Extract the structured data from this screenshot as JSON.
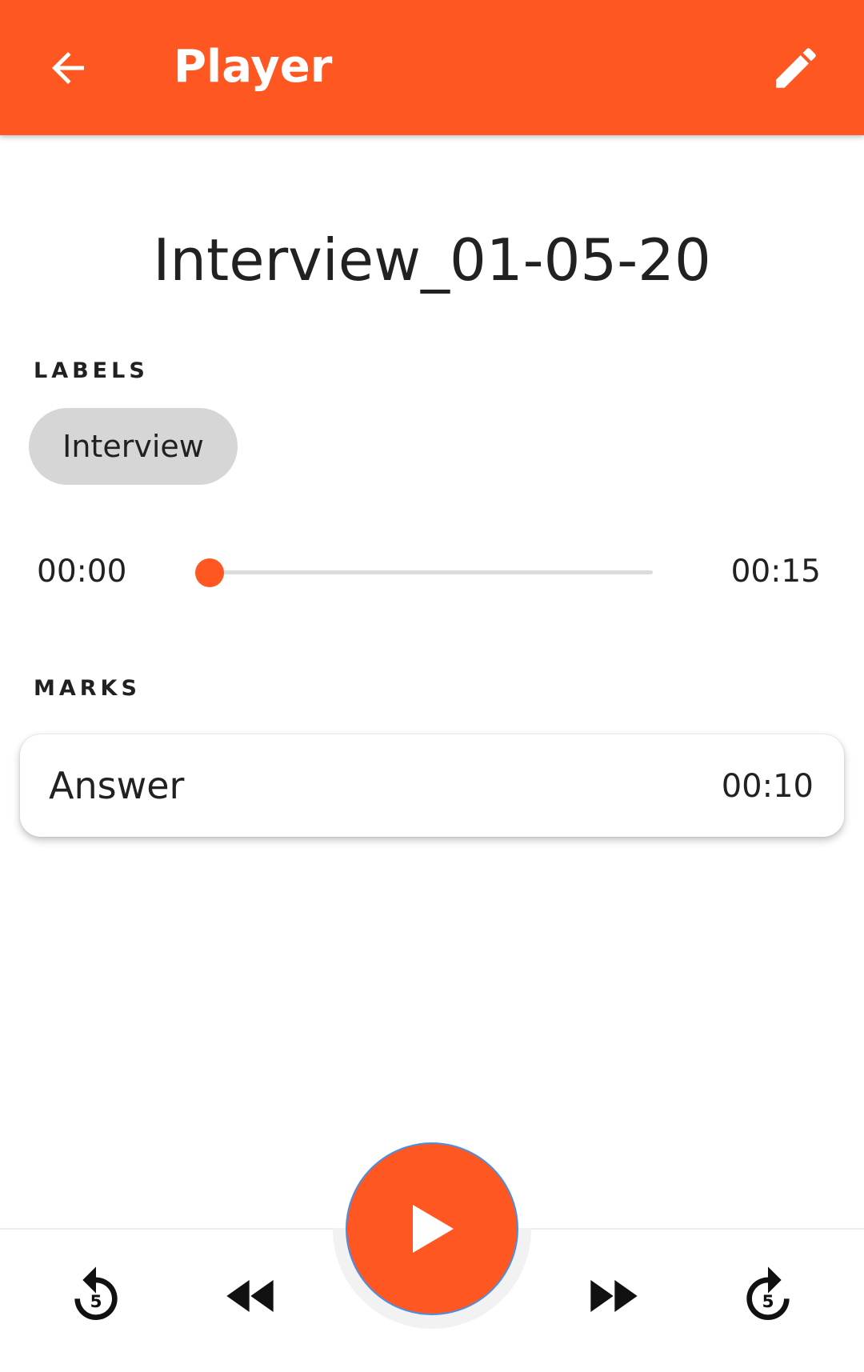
{
  "app_bar": {
    "title": "Player",
    "background": "#FF5722",
    "back_icon": "arrow-left-icon",
    "edit_icon": "pencil-icon"
  },
  "recording": {
    "title": "Interview_01-05-20"
  },
  "labels": {
    "heading": "LABELS",
    "chips": [
      "Interview"
    ]
  },
  "player": {
    "current_time": "00:00",
    "total_time": "00:15",
    "progress": 0,
    "accent": "#FF5722"
  },
  "marks": {
    "heading": "MARKS",
    "items": [
      {
        "name": "Answer",
        "time": "00:10"
      }
    ]
  },
  "controls": {
    "replay_seconds": "5",
    "forward_seconds": "5",
    "replay_icon": "replay-5-icon",
    "rewind_icon": "rewind-icon",
    "play_icon": "play-icon",
    "fast_forward_icon": "fast-forward-icon",
    "forward_icon": "forward-5-icon"
  }
}
